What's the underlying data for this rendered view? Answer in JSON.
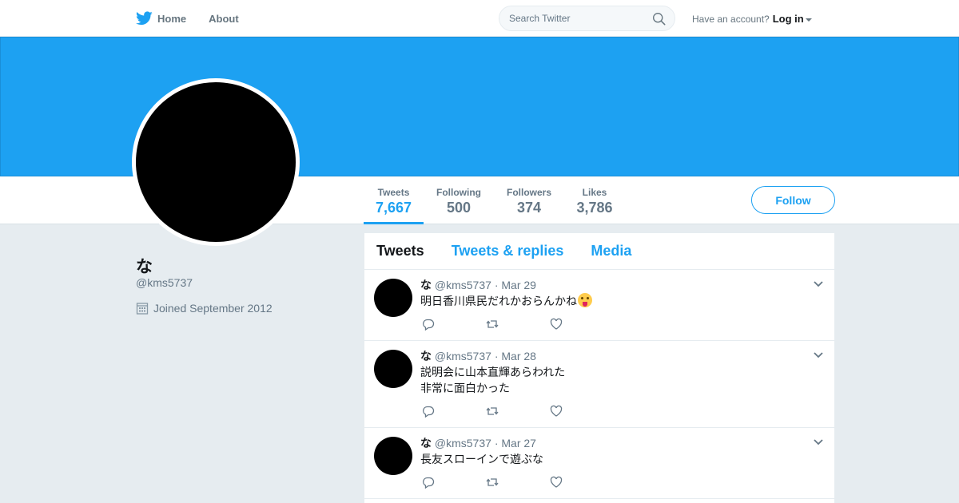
{
  "nav": {
    "home_label": "Home",
    "about_label": "About",
    "search_placeholder": "Search Twitter",
    "account_prompt": "Have an account?",
    "login_label": "Log in",
    "brand_color": "#1da1f2"
  },
  "stats": {
    "tweets_label": "Tweets",
    "tweets_value": "7,667",
    "following_label": "Following",
    "following_value": "500",
    "followers_label": "Followers",
    "followers_value": "374",
    "likes_label": "Likes",
    "likes_value": "3,786"
  },
  "follow_label": "Follow",
  "profile": {
    "name": "な",
    "handle": "@kms5737",
    "joined": "Joined September 2012"
  },
  "timeline_tabs": [
    "Tweets",
    "Tweets & replies",
    "Media"
  ],
  "tweets": [
    {
      "name": "な",
      "handle": "@kms5737",
      "date": "· Mar 29",
      "text": "明日香川県民だれかおらんかね",
      "emoji": "face-with-tongue"
    },
    {
      "name": "な",
      "handle": "@kms5737",
      "date": "· Mar 28",
      "text": "説明会に山本直輝あらわれた\n非常に面白かった"
    },
    {
      "name": "な",
      "handle": "@kms5737",
      "date": "· Mar 27",
      "text": "長友スローインで遊ぶな"
    }
  ],
  "icons": [
    "twitter-bird-icon",
    "search-icon",
    "calendar-icon",
    "chevron-down-icon",
    "reply-icon",
    "retweet-icon",
    "like-icon"
  ]
}
